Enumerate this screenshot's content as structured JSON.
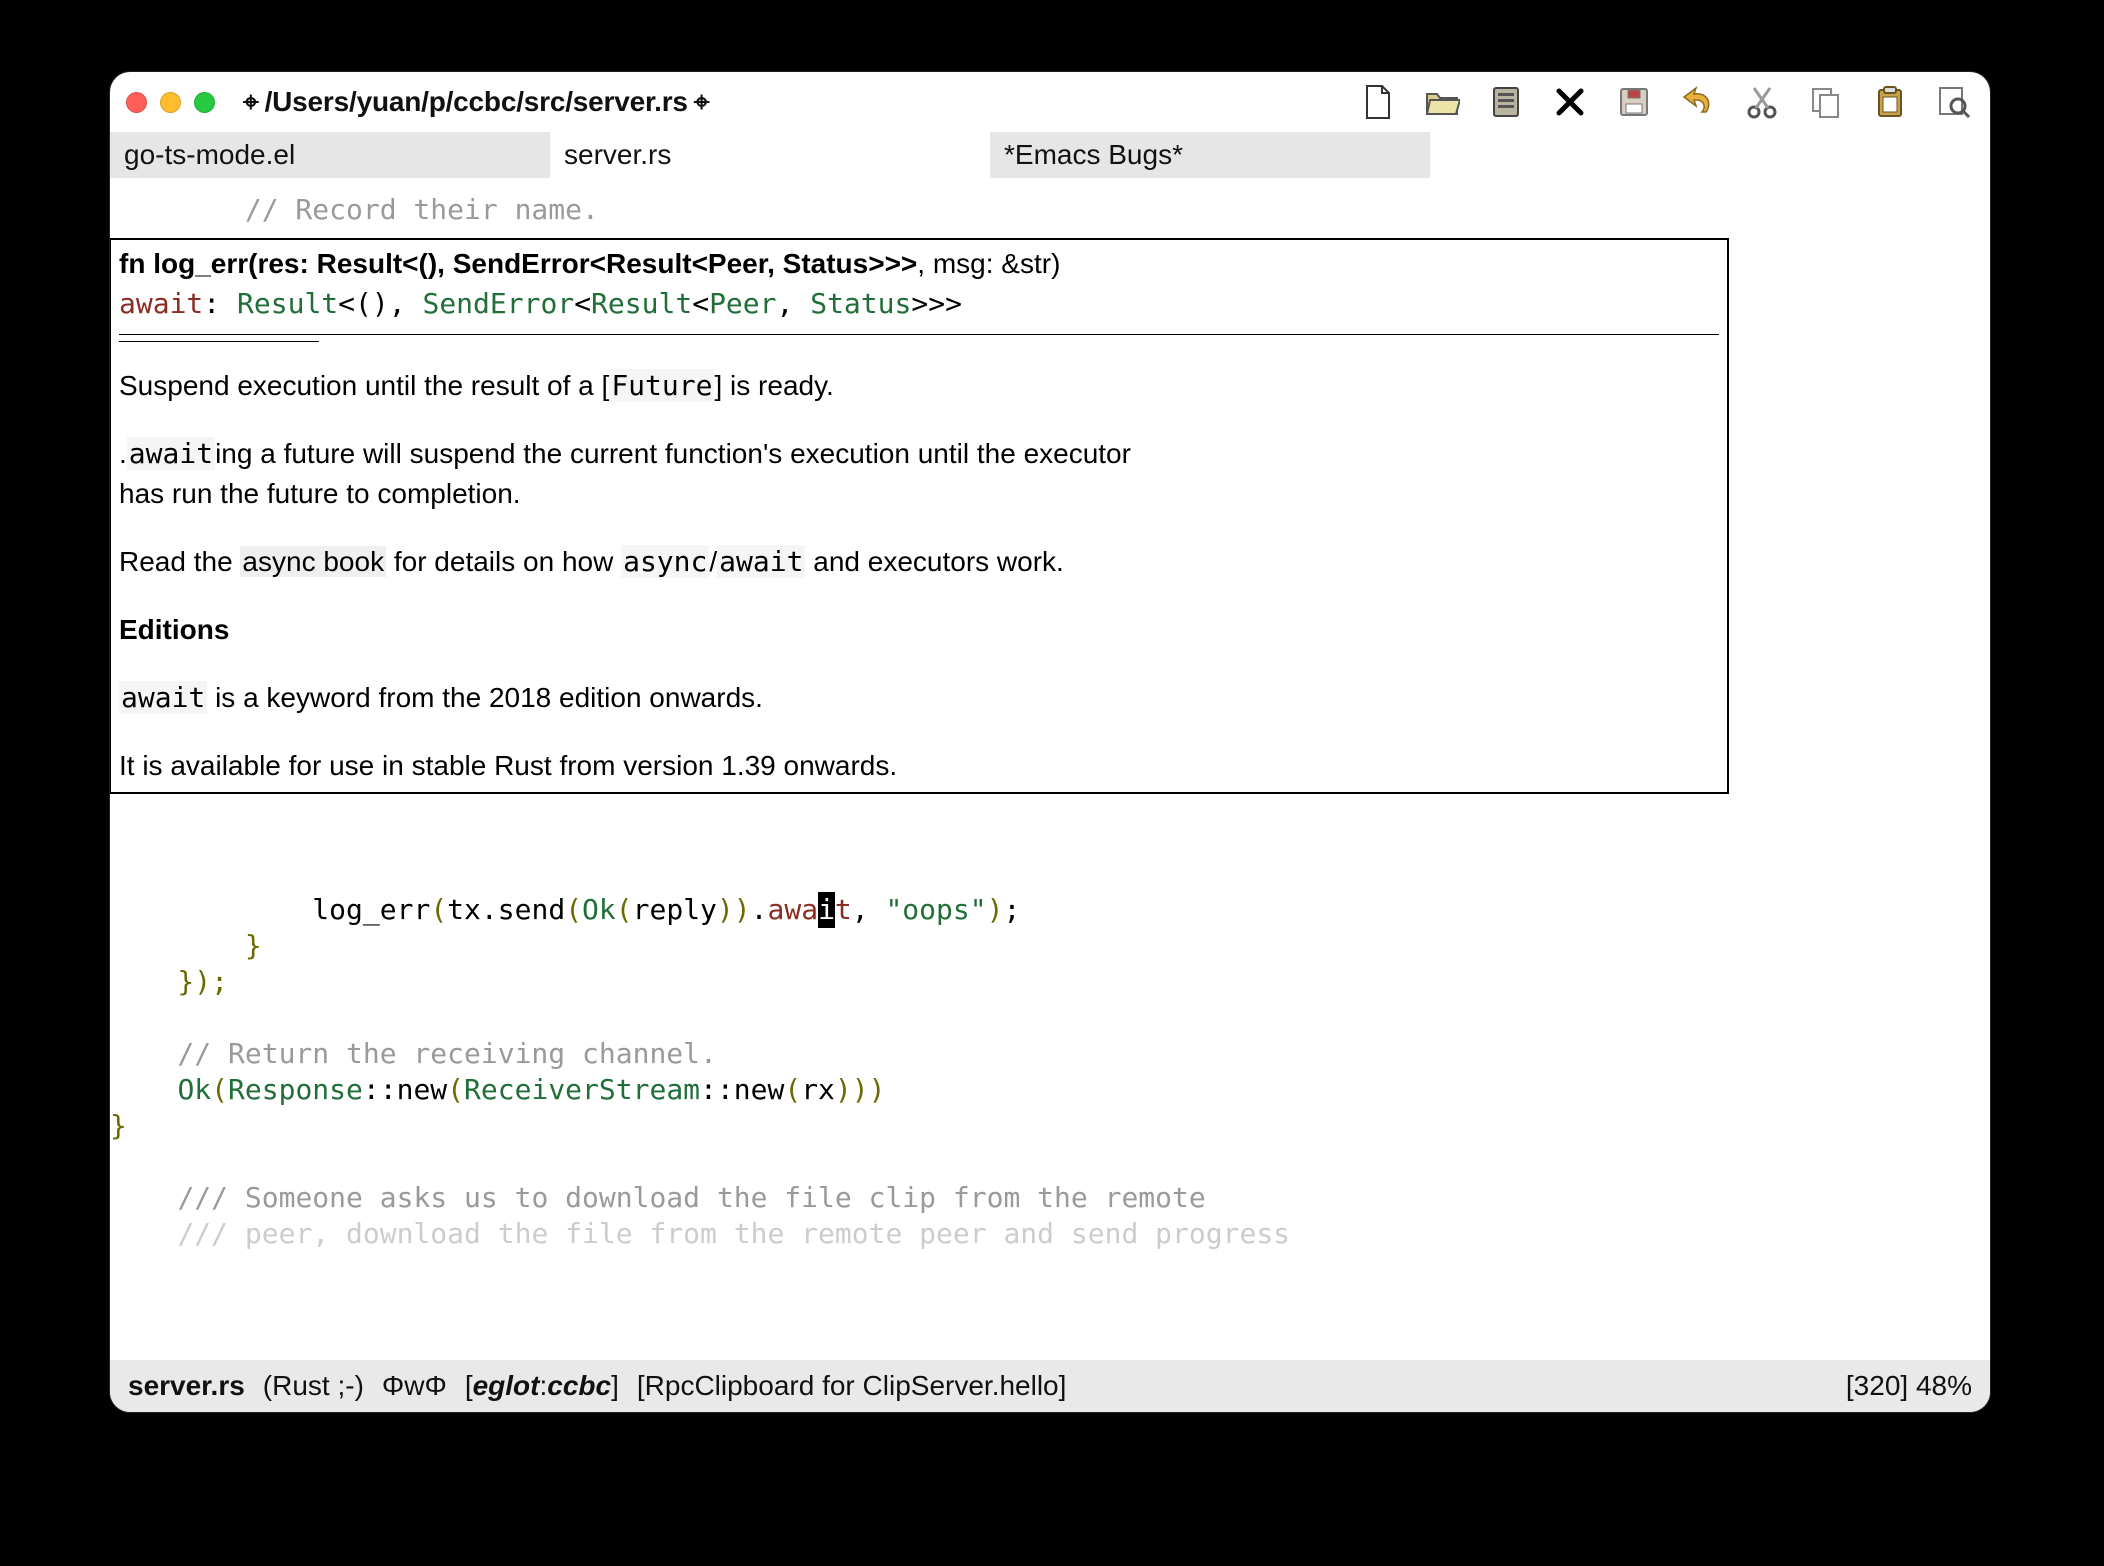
{
  "titlebar": {
    "path": "/Users/yuan/p/ccbc/src/server.rs",
    "saved_marker": "⌖"
  },
  "tabs": [
    {
      "label": "go-ts-mode.el",
      "state": "inactive"
    },
    {
      "label": "server.rs",
      "state": "active"
    },
    {
      "label": "*Emacs Bugs*",
      "state": "inactive"
    }
  ],
  "toolbar": {
    "new_file_label": "New file",
    "open_label": "Open",
    "folder_label": "Directory",
    "close_label": "Close",
    "save_label": "Save",
    "undo_label": "Undo",
    "cut_label": "Cut",
    "copy_label": "Copy",
    "paste_label": "Paste",
    "search_label": "Search"
  },
  "code_top": {
    "comment": "// Record their name."
  },
  "popup": {
    "sig_prefix": "fn log_err(res: Result<(), SendError<Result<Peer, Status>>>",
    "sig_suffix": ", msg: &str)",
    "sub_kw": "await",
    "sub_colon": ": ",
    "sub_ty_result": "Result",
    "sub_ty_unit": "<()",
    "sub_ty_comma1": ", ",
    "sub_ty_se": "SendError",
    "sub_ty_lt2": "<",
    "sub_ty_result2": "Result",
    "sub_ty_lt3": "<",
    "sub_ty_peer": "Peer",
    "sub_ty_comma2": ", ",
    "sub_ty_status": "Status",
    "sub_ty_close": ">>>",
    "doc_l1a": "Suspend execution until the result of a [",
    "doc_l1_future": "Future",
    "doc_l1b": "] is ready.",
    "doc_l2a": ".",
    "doc_l2_code": "await",
    "doc_l2b": "ing a future will suspend the current function's execution until the executor",
    "doc_l3": "has run the future to completion.",
    "doc_l4a": "Read the ",
    "doc_l4_link": "async book",
    "doc_l4b": " for details on how ",
    "doc_l4_async": "async",
    "doc_l4_slash": "/",
    "doc_l4_await": "await",
    "doc_l4c": " and executors work.",
    "editions_hdr": "Editions",
    "doc_l5_code": "await",
    "doc_l5b": " is a keyword from the 2018 edition onwards.",
    "doc_l6": "It is available for use in stable Rust from version 1.39 onwards."
  },
  "code_bottom": {
    "l1_indent": "            ",
    "l1_call": "log_err",
    "l1_p1": "(",
    "l1_tx": "tx.send",
    "l1_p2": "(",
    "l1_ok": "Ok",
    "l1_p3": "(",
    "l1_reply": "reply",
    "l1_p4": "))",
    "l1_dot": ".",
    "l1_awa": "awa",
    "l1_cursor": "i",
    "l1_t": "t",
    "l1_comma": ", ",
    "l1_str": "\"oops\"",
    "l1_p5": ")",
    "l1_semi": ";",
    "l2": "        }",
    "l3": "    });",
    "l4_blank": "",
    "l5": "    // Return the receiving channel.",
    "l6_indent": "    ",
    "l6_ok": "Ok",
    "l6_p1": "(",
    "l6_resp": "Response",
    "l6_cc": "::",
    "l6_new1": "new",
    "l6_p2": "(",
    "l6_recv": "ReceiverStream",
    "l6_cc2": "::",
    "l6_new2": "new",
    "l6_p3": "(",
    "l6_rx": "rx",
    "l6_p4": ")))",
    "l7": "}",
    "l8_blank": "",
    "l9": "/// Someone asks us to download the file clip from the remote",
    "l10": "/// peer, download the file from the remote peer and send progress"
  },
  "modeline": {
    "file": "server.rs",
    "mode": "(Rust ;-)",
    "phi": "ΦwΦ",
    "eglot_l": "[",
    "eglot_name": "eglot",
    "eglot_sep": ":",
    "eglot_proj": "ccbc",
    "eglot_r": "]",
    "which": "[RpcClipboard for ClipServer.hello]",
    "pos": "[320] 48%"
  }
}
